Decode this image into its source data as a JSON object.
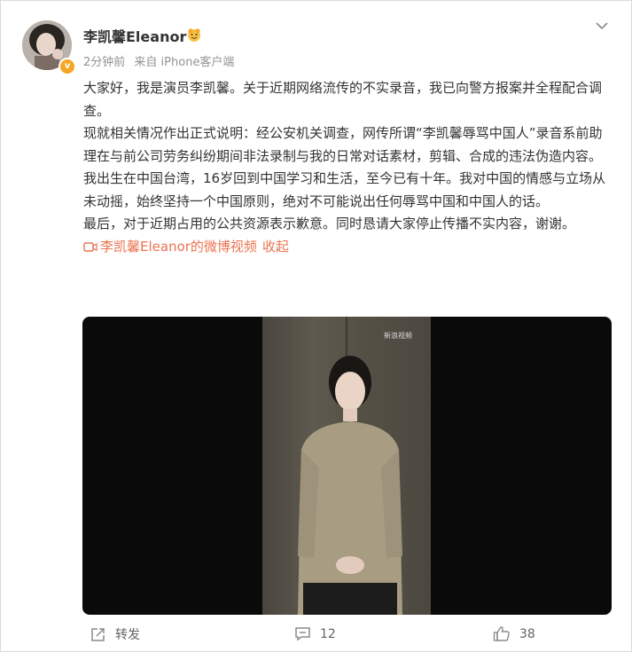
{
  "post": {
    "author": "李凯馨Eleanor",
    "time": "2分钟前",
    "source": "来自 iPhone客户端",
    "paragraphs": [
      "大家好，我是演员李凯馨。关于近期网络流传的不实录音，我已向警方报案并全程配合调查。",
      "现就相关情况作出正式说明：经公安机关调查，网传所谓“李凯馨辱骂中国人”录音系前助理在与前公司劳务纠纷期间非法录制与我的日常对话素材，剪辑、合成的违法伪造内容。",
      "我出生在中国台湾，16岁回到中国学习和生活，至今已有十年。我对中国的情感与立场从未动摇，始终坚持一个中国原则，绝对不可能说出任何辱骂中国和中国人的话。",
      "最后，对于近期占用的公共资源表示歉意。同时恳请大家停止传播不实内容，谢谢。"
    ],
    "video_link": "李凯馨Eleanor的微博视频",
    "fold_label": "收起",
    "video_watermark": "新浪视频"
  },
  "footer": {
    "repost_label": "转发",
    "comment_count": "12",
    "like_count": "38"
  },
  "colors": {
    "link": "#eb7350",
    "meta": "#939393",
    "verified": "#f5a623"
  }
}
